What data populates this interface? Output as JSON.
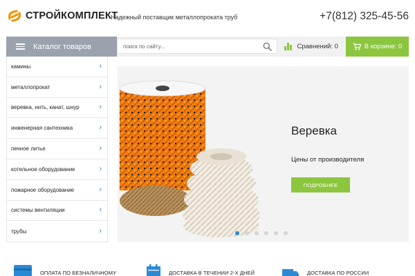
{
  "header": {
    "logo_text": "СТРОЙКОМПЛЕКТ",
    "tagline": "Надежный поставщик металлопроката труб",
    "phone": "+7(812) 325-45-56"
  },
  "navbar": {
    "catalog_label": "Каталог товаров",
    "search_placeholder": "поиск по сайту...",
    "compare_label": "Сравнений: 0",
    "cart_label": "В корзине: 0"
  },
  "sidebar": {
    "items": [
      {
        "label": "камины"
      },
      {
        "label": "металлопрокат"
      },
      {
        "label": "веревка, нить, канат, шнур"
      },
      {
        "label": "инженерная сантехника"
      },
      {
        "label": "печное литье"
      },
      {
        "label": "котельное оборудование"
      },
      {
        "label": "пожарное оборудование"
      },
      {
        "label": "системы вентиляции"
      },
      {
        "label": "трубы"
      }
    ]
  },
  "banner": {
    "title": "Веревка",
    "subtitle": "Цены от производителя",
    "button_label": "ПОДРОБНЕЕ",
    "slides_count": 6,
    "active_slide": 1
  },
  "features": [
    {
      "label": "ОПЛАТА ПО БЕЗНАЛИЧНОМУ",
      "icon": "card-icon"
    },
    {
      "label": "ДОСТАВКА В ТЕЧЕНИИ 2-Х ДНЕЙ",
      "icon": "calendar-icon"
    },
    {
      "label": "ДОСТАВКА ПО РОССИИ",
      "icon": "truck-icon"
    }
  ],
  "colors": {
    "accent_green": "#8cc63f",
    "accent_blue": "#2b8ad6",
    "logo_orange": "#f39200",
    "catalog_gray": "#9aa3ad"
  }
}
